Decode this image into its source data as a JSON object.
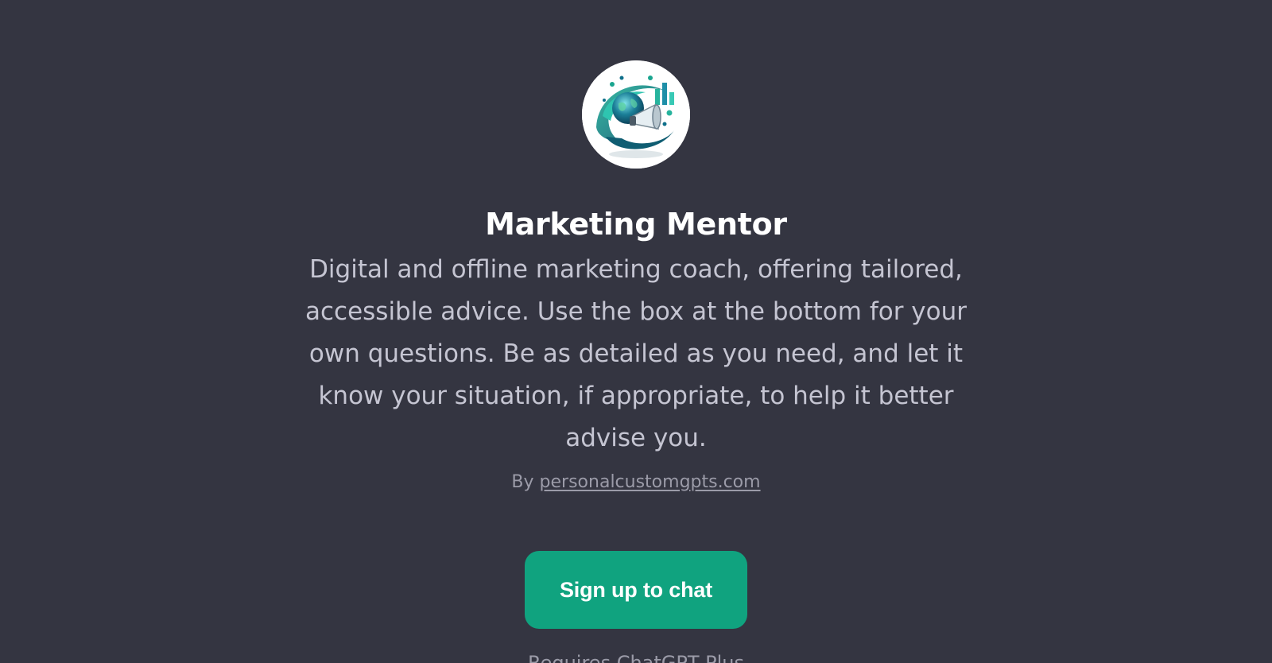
{
  "gpt": {
    "avatar_icon": "marketing-globe-megaphone-icon",
    "title": "Marketing Mentor",
    "description": "Digital and offline marketing coach, offering tailored, accessible advice. Use the box at the bottom for your own questions. Be as detailed as you need, and let it know your situation, if appropriate, to help it better advise you.",
    "by_prefix": "By",
    "author_link": "personalcustomgpts.com"
  },
  "actions": {
    "signup_label": "Sign up to chat"
  },
  "footer": {
    "text": "Requires ChatGPT Plus"
  },
  "colors": {
    "background": "#343541",
    "accent": "#10a37f",
    "title": "#ffffff",
    "body_text": "#c5c5d2",
    "muted_text": "#9b9ba8"
  }
}
